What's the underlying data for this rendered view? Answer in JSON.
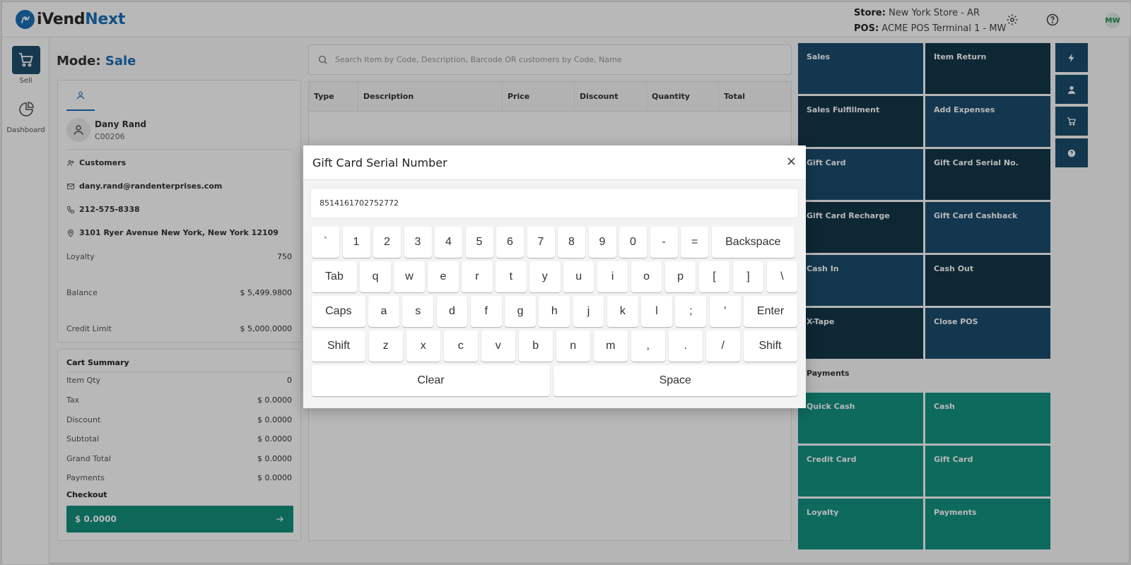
{
  "app": {
    "brand_prefix": "i",
    "brand_main": "Vend",
    "brand_suffix": "Next",
    "logo_mark": "iV"
  },
  "header": {
    "store_label": "Store:",
    "store_value": "New York Store - AR",
    "pos_label": "POS:",
    "pos_value": "ACME POS Terminal 1 - MW",
    "user_initials": "MW",
    "icons": [
      "gear-icon",
      "help-icon"
    ]
  },
  "nav": {
    "sell_label": "Sell",
    "dashboard_label": "Dashboard"
  },
  "mode": {
    "label": "Mode:",
    "value": "Sale"
  },
  "customer": {
    "name": "Dany Rand",
    "code": "C00206",
    "group": "Customers",
    "email": "dany.rand@randenterprises.com",
    "phone": "212-575-8338",
    "address": "3101 Ryer Avenue New York, New York 12109",
    "loyalty_label": "Loyalty",
    "loyalty_value": "750",
    "balance_label": "Balance",
    "balance_value": "$ 5,499.9800",
    "credit_label": "Credit Limit",
    "credit_value": "$ 5,000.0000"
  },
  "cart": {
    "title": "Cart Summary",
    "rows": [
      {
        "label": "Item Qty",
        "value": "0"
      },
      {
        "label": "Tax",
        "value": "$ 0.0000"
      },
      {
        "label": "Discount",
        "value": "$ 0.0000"
      },
      {
        "label": "Subtotal",
        "value": "$ 0.0000"
      },
      {
        "label": "Grand Total",
        "value": "$ 0.0000"
      },
      {
        "label": "Payments",
        "value": "$ 0.0000"
      }
    ],
    "checkout_label": "Checkout",
    "checkout_amount": "$ 0.0000"
  },
  "search": {
    "placeholder": "Search Item by Code, Description, Barcode OR customers by Code, Name"
  },
  "table": {
    "columns": [
      "Type",
      "Description",
      "Price",
      "Discount",
      "Quantity",
      "Total"
    ]
  },
  "actions": [
    {
      "label": "Sales",
      "style": "blue"
    },
    {
      "label": "Item Return",
      "style": "dark"
    },
    {
      "label": "Sales Fulfillment",
      "style": "dark"
    },
    {
      "label": "Add Expenses",
      "style": "blue"
    },
    {
      "label": "Gift Card",
      "style": "blue"
    },
    {
      "label": "Gift Card Serial No.",
      "style": "dark"
    },
    {
      "label": "Gift Card Recharge",
      "style": "dark"
    },
    {
      "label": "Gift Card Cashback",
      "style": "blue"
    },
    {
      "label": "Cash In",
      "style": "blue"
    },
    {
      "label": "Cash Out",
      "style": "dark"
    },
    {
      "label": "X-Tape",
      "style": "dark"
    },
    {
      "label": "Close POS",
      "style": "blue"
    }
  ],
  "payments_title": "Payments",
  "payments": [
    {
      "label": "Quick Cash"
    },
    {
      "label": "Cash"
    },
    {
      "label": "Credit Card"
    },
    {
      "label": "Gift Card"
    },
    {
      "label": "Loyalty"
    },
    {
      "label": "Payments"
    }
  ],
  "side_buttons": [
    "bolt-icon",
    "user-icon",
    "cart-icon",
    "help-circle-icon"
  ],
  "modal": {
    "title": "Gift Card Serial Number",
    "close": "×",
    "input_value": "8514161702752772",
    "keyboard": [
      [
        "`",
        "1",
        "2",
        "3",
        "4",
        "5",
        "6",
        "7",
        "8",
        "9",
        "0",
        "-",
        "=",
        "Backspace"
      ],
      [
        "Tab",
        "q",
        "w",
        "e",
        "r",
        "t",
        "y",
        "u",
        "i",
        "o",
        "p",
        "[",
        "]",
        "\\"
      ],
      [
        "Caps",
        "a",
        "s",
        "d",
        "f",
        "g",
        "h",
        "j",
        "k",
        "l",
        ";",
        "'",
        "Enter"
      ],
      [
        "Shift",
        "z",
        "x",
        "c",
        "v",
        "b",
        "n",
        "m",
        ",",
        ".",
        "/",
        "Shift"
      ],
      [
        "Clear",
        "Space"
      ]
    ]
  }
}
